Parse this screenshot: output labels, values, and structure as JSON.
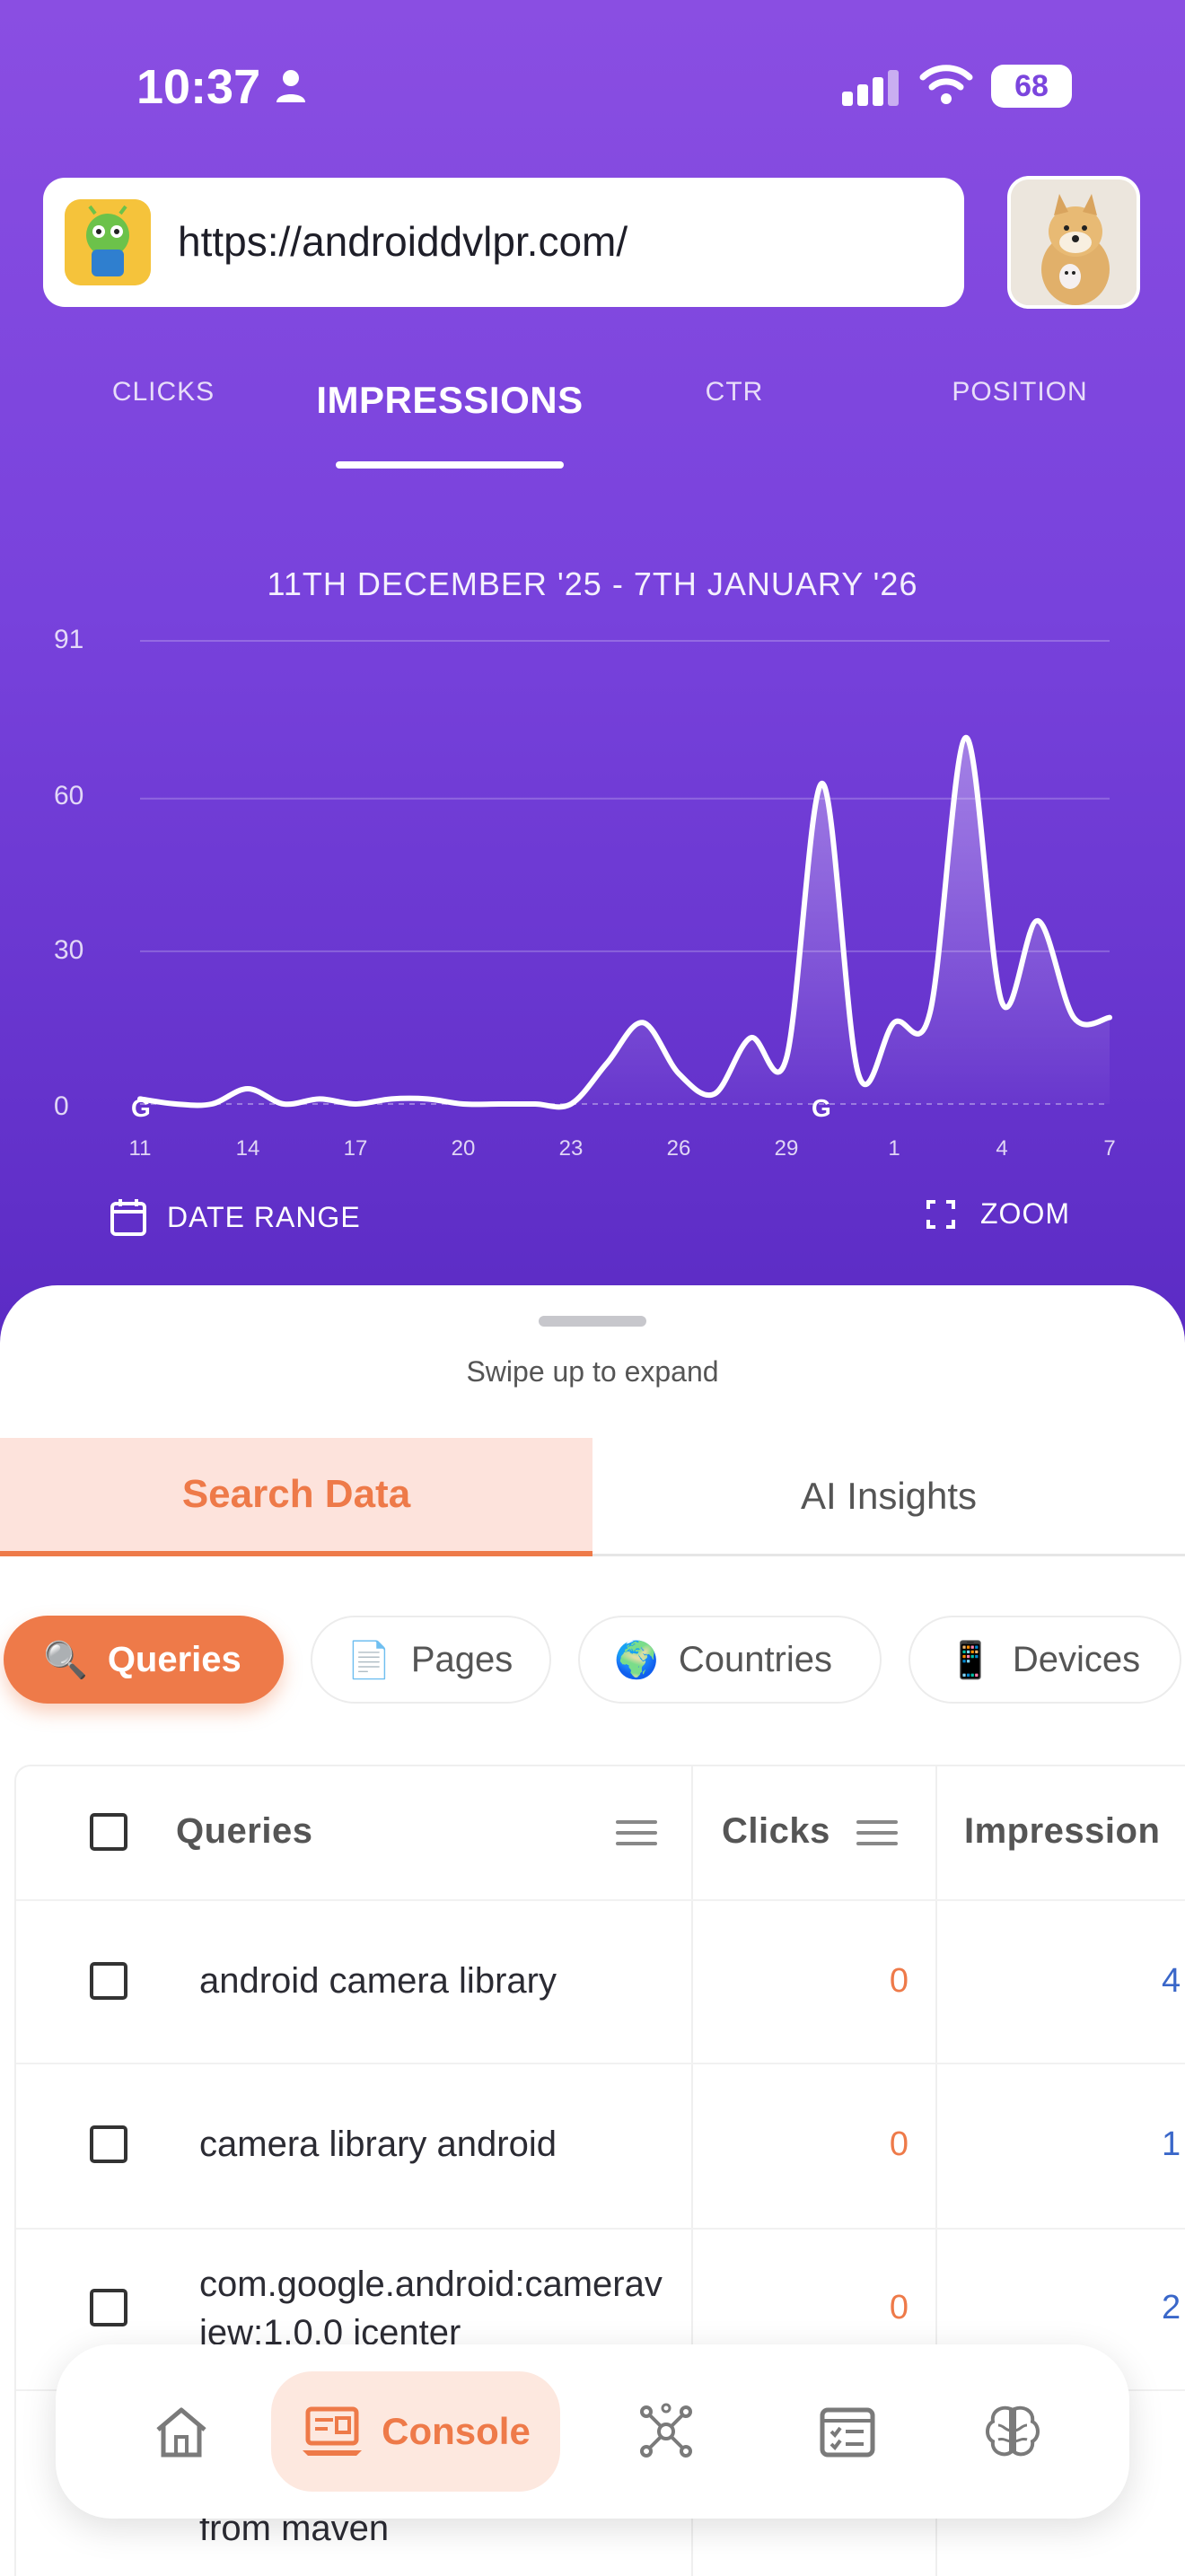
{
  "status_bar": {
    "time": "10:37",
    "battery": "68"
  },
  "url_bar": {
    "url": "https://androiddvlpr.com/"
  },
  "metric_tabs": [
    {
      "label": "CLICKS",
      "active": false
    },
    {
      "label": "IMPRESSIONS",
      "active": true
    },
    {
      "label": "CTR",
      "active": false
    },
    {
      "label": "POSITION",
      "active": false
    }
  ],
  "chart_data": {
    "type": "line",
    "title": "11TH DECEMBER '25 - 7TH JANUARY '26",
    "x_tick_labels": [
      "11",
      "14",
      "17",
      "20",
      "23",
      "26",
      "29",
      "1",
      "4",
      "7"
    ],
    "y_tick_labels": [
      "91",
      "60",
      "30",
      "0"
    ],
    "ylim": [
      0,
      91
    ],
    "grid": true,
    "annotations": [
      "G",
      "G"
    ],
    "x": [
      "Dec 11",
      "Dec 12",
      "Dec 13",
      "Dec 14",
      "Dec 15",
      "Dec 16",
      "Dec 17",
      "Dec 18",
      "Dec 19",
      "Dec 20",
      "Dec 21",
      "Dec 22",
      "Dec 23",
      "Dec 24",
      "Dec 25",
      "Dec 26",
      "Dec 27",
      "Dec 28",
      "Dec 29",
      "Dec 30",
      "Dec 31",
      "Jan 1",
      "Jan 2",
      "Jan 3",
      "Jan 4",
      "Jan 5",
      "Jan 6",
      "Jan 7"
    ],
    "series": [
      {
        "values": [
          1,
          0,
          0,
          3,
          0,
          1,
          0,
          1,
          1,
          0,
          0,
          0,
          0,
          8,
          16,
          6,
          2,
          13,
          9,
          63,
          6,
          16,
          18,
          72,
          20,
          36,
          17,
          17
        ]
      }
    ]
  },
  "actions": {
    "date_range": "DATE RANGE",
    "zoom": "ZOOM"
  },
  "sheet": {
    "hint": "Swipe up to expand"
  },
  "segments": {
    "search_data": "Search Data",
    "ai_insights": "AI Insights"
  },
  "chips": [
    {
      "emoji": "🔍",
      "label": "Queries",
      "active": true
    },
    {
      "emoji": "📄",
      "label": "Pages",
      "active": false
    },
    {
      "emoji": "🌍",
      "label": "Countries",
      "active": false
    },
    {
      "emoji": "📱",
      "label": "Devices",
      "active": false
    }
  ],
  "table": {
    "headers": {
      "queries": "Queries",
      "clicks": "Clicks",
      "impressions": "Impression"
    },
    "rows": [
      {
        "query": "android camera library",
        "clicks": "0",
        "impressions": "4"
      },
      {
        "query": "camera library android",
        "clicks": "0",
        "impressions": "1"
      },
      {
        "query": "com.google.android:cameraview:1.0.0 icenter",
        "clicks": "0",
        "impressions": "2"
      },
      {
        "query": "from maven",
        "clicks": "",
        "impressions": ""
      }
    ]
  },
  "bottom_nav": [
    {
      "icon": "home-icon",
      "label": ""
    },
    {
      "icon": "console-icon",
      "label": "Console"
    },
    {
      "icon": "network-icon",
      "label": ""
    },
    {
      "icon": "checklist-icon",
      "label": ""
    },
    {
      "icon": "brain-icon",
      "label": ""
    }
  ]
}
